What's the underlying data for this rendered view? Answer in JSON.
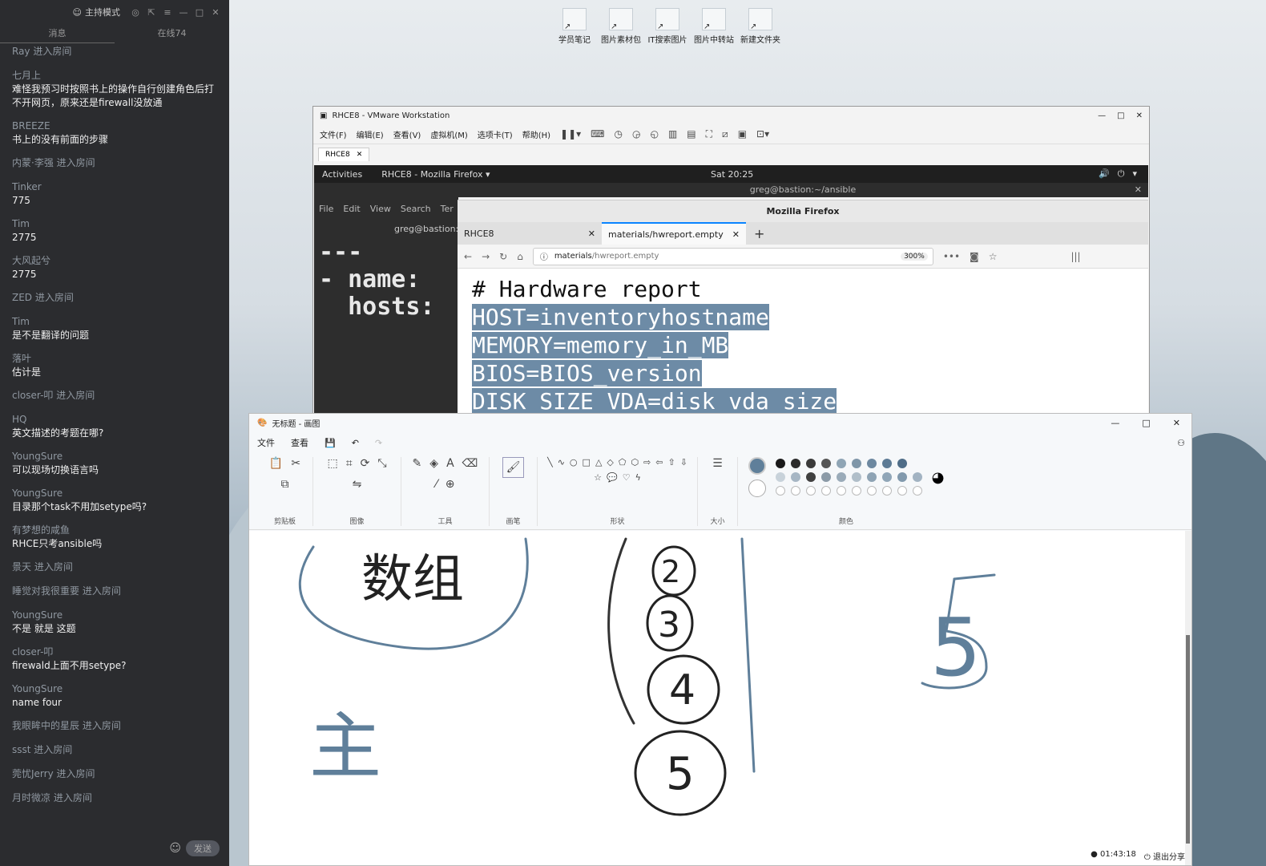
{
  "chat": {
    "mode_label": "主持模式",
    "tab_left": "消息",
    "tab_right": "在线74",
    "messages": [
      {
        "type": "enter",
        "text": "Ray 进入房间"
      },
      {
        "type": "msg",
        "name": "七月上",
        "text": "难怪我预习时按照书上的操作自行创建角色后打不开网页，原来还是firewall没放通"
      },
      {
        "type": "msg",
        "name": "BREEZE",
        "text": "书上的没有前面的步骤"
      },
      {
        "type": "enter",
        "text": "内蒙·李强 进入房间"
      },
      {
        "type": "msg",
        "name": "Tinker",
        "text": "775"
      },
      {
        "type": "msg",
        "name": "Tim",
        "text": "2775"
      },
      {
        "type": "msg",
        "name": "大风起兮",
        "text": "2775"
      },
      {
        "type": "enter",
        "text": "ZED 进入房间"
      },
      {
        "type": "msg",
        "name": "Tim",
        "text": "是不是翻译的问题"
      },
      {
        "type": "msg",
        "name": "落叶",
        "text": "估计是"
      },
      {
        "type": "enter",
        "text": "closer-叩    进入房间"
      },
      {
        "type": "msg",
        "name": "HQ",
        "text": "英文描述的考题在哪?"
      },
      {
        "type": "msg",
        "name": "YoungSure",
        "text": "可以现场切换语言吗"
      },
      {
        "type": "msg",
        "name": "YoungSure",
        "text": "目录那个task不用加setype吗?"
      },
      {
        "type": "msg",
        "name": "有梦想的咸鱼",
        "text": "RHCE只考ansible吗"
      },
      {
        "type": "enter",
        "text": "景天 进入房间"
      },
      {
        "type": "enter",
        "text": "睡觉对我很重要 进入房间"
      },
      {
        "type": "msg",
        "name": "YoungSure",
        "text": "不是  就是 这题"
      },
      {
        "type": "msg",
        "name": "closer-叩",
        "text": "firewald上面不用setype?"
      },
      {
        "type": "msg",
        "name": "YoungSure",
        "text": "name four"
      },
      {
        "type": "enter",
        "text": "我眼眸中的星辰 进入房间"
      },
      {
        "type": "enter",
        "text": "ssst 进入房间"
      },
      {
        "type": "enter",
        "text": "莞忧Jerry 进入房间"
      },
      {
        "type": "enter",
        "text": "月时微凉 进入房间"
      }
    ],
    "send_label": "发送"
  },
  "desktop": {
    "icons": [
      "学员笔记",
      "图片素材包",
      "IT搜索图片",
      "图片中转站",
      "新建文件夹"
    ]
  },
  "vmware": {
    "title": "RHCE8 - VMware Workstation",
    "menu": [
      "文件(F)",
      "编辑(E)",
      "查看(V)",
      "虚拟机(M)",
      "选项卡(T)",
      "帮助(H)"
    ],
    "tab": "RHCE8"
  },
  "gnome": {
    "activities": "Activities",
    "app": "RHCE8 - Mozilla Firefox ▾",
    "clock": "Sat 20:25"
  },
  "terminal": {
    "title": "greg@bastion:~/ansible",
    "menu": [
      "File",
      "Edit",
      "View",
      "Search",
      "Ter"
    ],
    "path": "greg@bastion:",
    "lines": [
      "---",
      "- name: ",
      "  hosts: "
    ]
  },
  "firefox": {
    "window_title": "Mozilla Firefox",
    "tabs": [
      "RHCE8",
      "materials/hwreport.empty"
    ],
    "url_host": "materials",
    "url_path": "/hwreport.empty",
    "zoom": "300%",
    "content": [
      "# Hardware report",
      "HOST=inventoryhostname",
      "MEMORY=memory_in_MB",
      "BIOS=BIOS_version",
      "DISK_SIZE_VDA=disk_vda_size"
    ]
  },
  "paint": {
    "title": "无标题 - 画图",
    "menu": [
      "文件",
      "查看"
    ],
    "groups": [
      "剪贴板",
      "图像",
      "工具",
      "画笔",
      "形状",
      "大小",
      "颜色"
    ],
    "canvas_text": [
      "数组",
      "主",
      "2",
      "3",
      "4",
      "5",
      "5"
    ],
    "status": {
      "time": "01:43:18",
      "exit": "退出分享"
    }
  },
  "colors": {
    "palette_row1": [
      "#1a1a1a",
      "#2b2b2b",
      "#3a3a3a",
      "#555555",
      "#8fa5b5",
      "#7f96a8",
      "#6d88a0",
      "#5d7b95",
      "#4f6d88"
    ],
    "palette_row2": [
      "#c8d2da",
      "#a6b6c4",
      "#404040",
      "#8b9aa7",
      "#9aabb9",
      "#b0bec9",
      "#8ea3b4",
      "#90a6b8",
      "#8199ad",
      "#a2b3c2"
    ],
    "stroke": "#5f7f9a"
  }
}
